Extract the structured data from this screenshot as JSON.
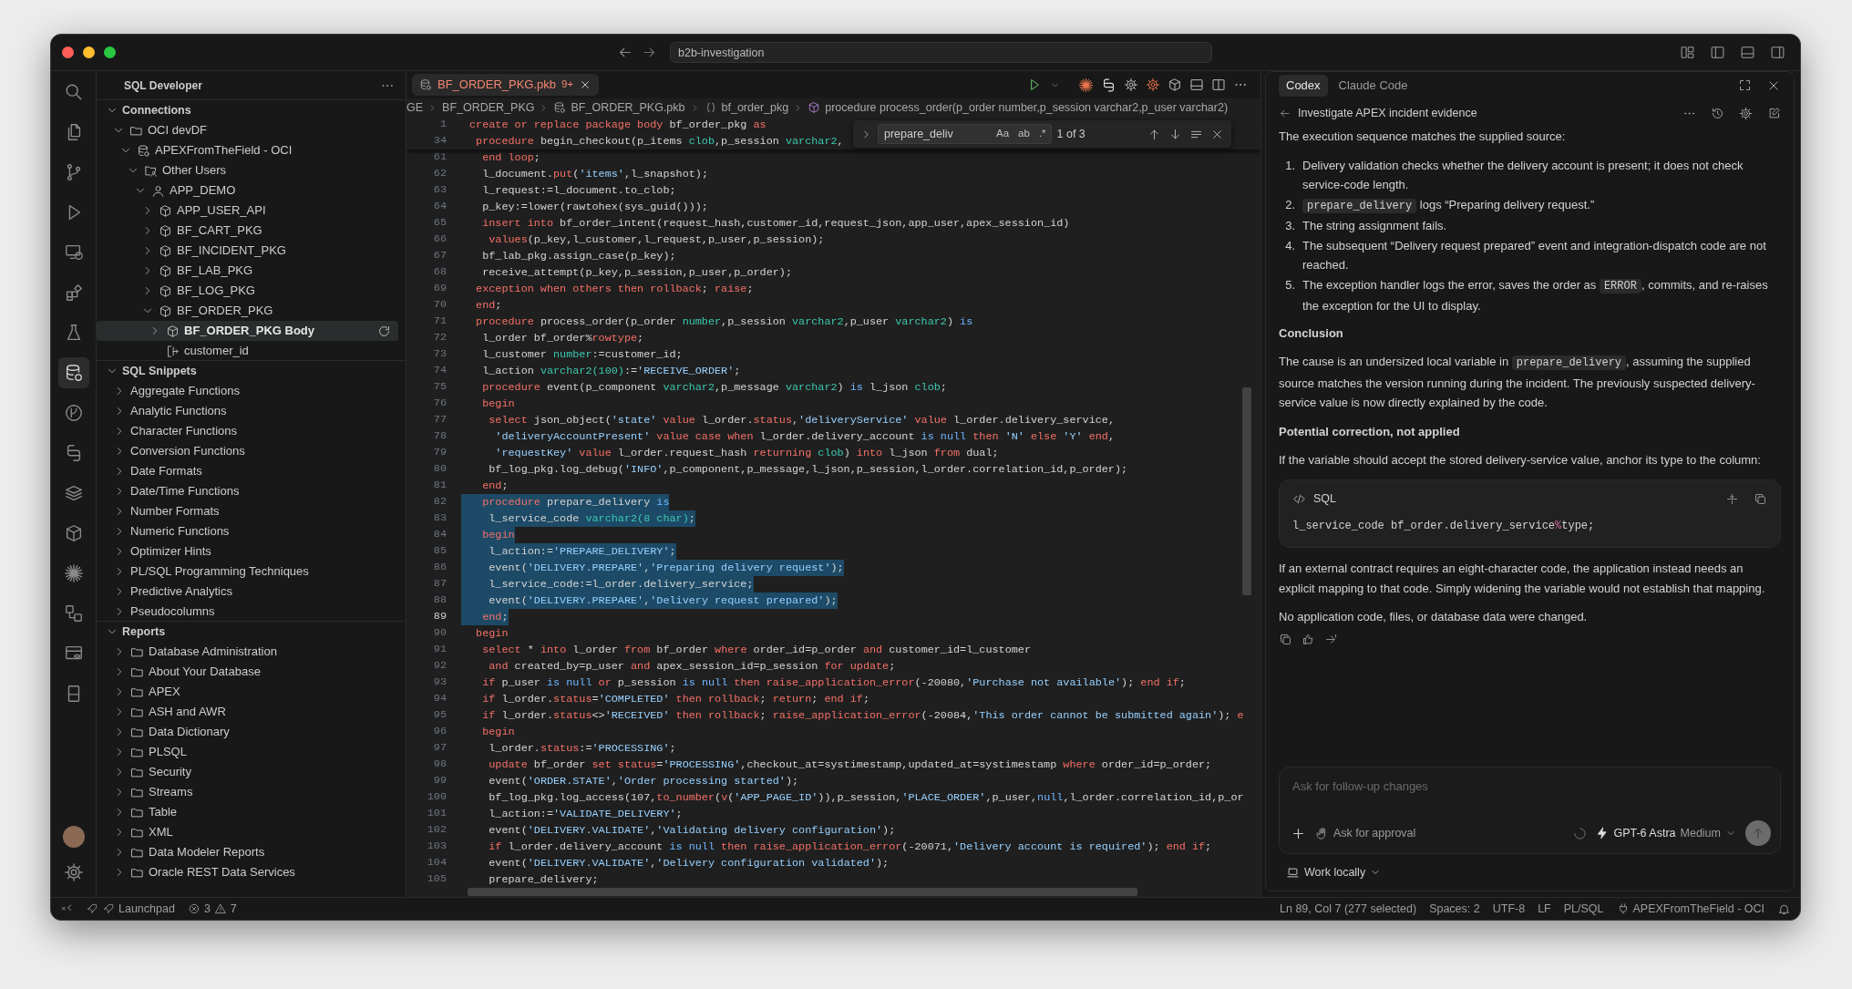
{
  "window": {
    "title": "b2b-investigation"
  },
  "sidebar": {
    "title": "SQL Developer",
    "sections": [
      {
        "title": "Connections",
        "expanded": true,
        "items": [
          {
            "label": "OCI devDF",
            "kind": "folder",
            "expanded": true,
            "selected": false,
            "children": [
              {
                "label": "APEXFromTheField - OCI",
                "kind": "connection",
                "expanded": true,
                "selected": false,
                "children": [
                  {
                    "label": "Other Users",
                    "kind": "users-folder",
                    "expanded": true,
                    "selected": false,
                    "children": [
                      {
                        "label": "APP_DEMO",
                        "kind": "user",
                        "expanded": true,
                        "selected": false,
                        "children": [
                          {
                            "label": "APP_USER_API",
                            "kind": "package",
                            "expanded": false,
                            "selected": false
                          },
                          {
                            "label": "BF_CART_PKG",
                            "kind": "package",
                            "expanded": false,
                            "selected": false
                          },
                          {
                            "label": "BF_INCIDENT_PKG",
                            "kind": "package",
                            "expanded": false,
                            "selected": false
                          },
                          {
                            "label": "BF_LAB_PKG",
                            "kind": "package",
                            "expanded": false,
                            "selected": false
                          },
                          {
                            "label": "BF_LOG_PKG",
                            "kind": "package",
                            "expanded": false,
                            "selected": false
                          },
                          {
                            "label": "BF_ORDER_PKG",
                            "kind": "package",
                            "expanded": true,
                            "selected": false,
                            "children": [
                              {
                                "label": "BF_ORDER_PKG Body",
                                "kind": "package",
                                "expanded": false,
                                "selected": true
                              },
                              {
                                "label": "customer_id",
                                "kind": "column",
                                "selected": false
                              }
                            ]
                          }
                        ]
                      }
                    ]
                  }
                ]
              }
            ]
          }
        ]
      },
      {
        "title": "SQL Snippets",
        "expanded": true,
        "items": [
          {
            "label": "Aggregate Functions",
            "expanded": false,
            "selected": false
          },
          {
            "label": "Analytic Functions",
            "expanded": false,
            "selected": false
          },
          {
            "label": "Character Functions",
            "expanded": false,
            "selected": false
          },
          {
            "label": "Conversion Functions",
            "expanded": false,
            "selected": false
          },
          {
            "label": "Date Formats",
            "expanded": false,
            "selected": false
          },
          {
            "label": "Date/Time Functions",
            "expanded": false,
            "selected": false
          },
          {
            "label": "Number Formats",
            "expanded": false,
            "selected": false
          },
          {
            "label": "Numeric Functions",
            "expanded": false,
            "selected": false
          },
          {
            "label": "Optimizer Hints",
            "expanded": false,
            "selected": false
          },
          {
            "label": "PL/SQL Programming Techniques",
            "expanded": false,
            "selected": false
          },
          {
            "label": "Predictive Analytics",
            "expanded": false,
            "selected": false
          },
          {
            "label": "Pseudocolumns",
            "expanded": false,
            "selected": false
          }
        ]
      },
      {
        "title": "Reports",
        "expanded": true,
        "items": [
          {
            "label": "Database Administration",
            "kind": "folder",
            "expanded": false,
            "selected": false
          },
          {
            "label": "About Your Database",
            "kind": "folder",
            "expanded": false,
            "selected": false
          },
          {
            "label": "APEX",
            "kind": "folder",
            "expanded": false,
            "selected": false
          },
          {
            "label": "ASH and AWR",
            "kind": "folder",
            "expanded": false,
            "selected": false
          },
          {
            "label": "Data Dictionary",
            "kind": "folder",
            "expanded": false,
            "selected": false
          },
          {
            "label": "PLSQL",
            "kind": "folder",
            "expanded": false,
            "selected": false
          },
          {
            "label": "Security",
            "kind": "folder",
            "expanded": false,
            "selected": false
          },
          {
            "label": "Streams",
            "kind": "folder",
            "expanded": false,
            "selected": false
          },
          {
            "label": "Table",
            "kind": "folder",
            "expanded": false,
            "selected": false
          },
          {
            "label": "XML",
            "kind": "folder",
            "expanded": false,
            "selected": false
          },
          {
            "label": "Data Modeler Reports",
            "kind": "folder",
            "expanded": false,
            "selected": false
          },
          {
            "label": "Oracle REST Data Services",
            "kind": "folder",
            "expanded": false,
            "selected": false
          }
        ]
      }
    ]
  },
  "editor": {
    "tabs": [
      {
        "label": "BF_ORDER_PKG.pkb",
        "badge": "9+",
        "selected": true
      }
    ],
    "breadcrumb": [
      {
        "label": "GE",
        "kind": "folder"
      },
      {
        "label": "BF_ORDER_PKG",
        "kind": "folder"
      },
      {
        "label": "BF_ORDER_PKG.pkb",
        "kind": "file"
      },
      {
        "label": "bf_order_pkg",
        "kind": "namespace"
      },
      {
        "label": "procedure process_order(p_order number,p_session varchar2,p_user varchar2)",
        "kind": "method"
      }
    ],
    "find": {
      "value": "prepare_deliv",
      "options": [
        "Aa",
        "ab",
        ".*"
      ],
      "count": "1 of 3"
    },
    "lines": [
      {
        "number": "1",
        "sticky": true,
        "selected": false,
        "spans": [
          {
            "text": "create or replace package body",
            "kind": "keyword"
          },
          " bf_order_pkg ",
          {
            "text": "as",
            "kind": "keyword"
          }
        ]
      },
      {
        "number": "34",
        "sticky": true,
        "selected": false,
        "spans": [
          {
            "text": " procedure",
            "kind": "keyword"
          },
          " begin_checkout(p_items ",
          {
            "text": "clob",
            "kind": "type"
          },
          ",p_session ",
          {
            "text": "varchar2",
            "kind": "type"
          },
          ","
        ]
      },
      {
        "number": "61",
        "selected": false,
        "spans": [
          {
            "text": "  end loop",
            "kind": "keyword"
          },
          ";"
        ]
      },
      {
        "number": "62",
        "selected": false,
        "spans": [
          "  l_document.",
          {
            "text": "put",
            "kind": "keyword"
          },
          "(",
          {
            "text": "'items'",
            "kind": "string"
          },
          ",l_snapshot);"
        ]
      },
      {
        "number": "63",
        "selected": false,
        "spans": [
          "  l_request:=l_document.to_clob;"
        ]
      },
      {
        "number": "64",
        "selected": false,
        "spans": [
          "  p_key:=lower(rawtohex(sys_guid()));"
        ]
      },
      {
        "number": "65",
        "selected": false,
        "spans": [
          {
            "text": "  insert into",
            "kind": "keyword"
          },
          " bf_order_intent(request_hash,customer_id,request_json,app_user,apex_session_id)"
        ]
      },
      {
        "number": "66",
        "selected": false,
        "spans": [
          {
            "text": "   values",
            "kind": "keyword"
          },
          "(p_key,l_customer,l_request,p_user,p_session);"
        ]
      },
      {
        "number": "67",
        "selected": false,
        "spans": [
          "  bf_lab_pkg.assign_case(p_key);"
        ]
      },
      {
        "number": "68",
        "selected": false,
        "spans": [
          "  receive_attempt(p_key,p_session,p_user,p_order);"
        ]
      },
      {
        "number": "69",
        "selected": false,
        "spans": [
          {
            "text": " exception when others then rollback",
            "kind": "keyword"
          },
          "; ",
          {
            "text": "raise",
            "kind": "keyword"
          },
          ";"
        ]
      },
      {
        "number": "70",
        "selected": false,
        "spans": [
          {
            "text": " end",
            "kind": "keyword"
          },
          ";"
        ]
      },
      {
        "number": "71",
        "selected": false,
        "spans": [
          {
            "text": " procedure",
            "kind": "keyword"
          },
          " process_order(p_order ",
          {
            "text": "number",
            "kind": "type"
          },
          ",p_session ",
          {
            "text": "varchar2",
            "kind": "type"
          },
          ",p_user ",
          {
            "text": "varchar2",
            "kind": "type"
          },
          ") ",
          {
            "text": "is",
            "kind": "literal"
          }
        ]
      },
      {
        "number": "72",
        "selected": false,
        "spans": [
          "  l_order bf_order%",
          {
            "text": "rowtype",
            "kind": "keyword"
          },
          ";"
        ]
      },
      {
        "number": "73",
        "selected": false,
        "spans": [
          "  l_customer ",
          {
            "text": "number",
            "kind": "type"
          },
          ":=customer_id;"
        ]
      },
      {
        "number": "74",
        "selected": false,
        "spans": [
          "  l_action ",
          {
            "text": "varchar2(100)",
            "kind": "type"
          },
          ":=",
          {
            "text": "'RECEIVE_ORDER'",
            "kind": "string"
          },
          ";"
        ]
      },
      {
        "number": "75",
        "selected": false,
        "spans": [
          {
            "text": "  procedure",
            "kind": "keyword"
          },
          " event(p_component ",
          {
            "text": "varchar2",
            "kind": "type"
          },
          ",p_message ",
          {
            "text": "varchar2",
            "kind": "type"
          },
          ") ",
          {
            "text": "is",
            "kind": "literal"
          },
          " l_json ",
          {
            "text": "clob",
            "kind": "type"
          },
          ";"
        ]
      },
      {
        "number": "76",
        "selected": false,
        "spans": [
          {
            "text": "  begin",
            "kind": "keyword"
          }
        ]
      },
      {
        "number": "77",
        "selected": false,
        "spans": [
          {
            "text": "   select",
            "kind": "keyword"
          },
          " json_object(",
          {
            "text": "'state' ",
            "kind": "string"
          },
          {
            "text": "value",
            "kind": "keyword"
          },
          " l_order.",
          {
            "text": "status",
            "kind": "keyword"
          },
          ",",
          {
            "text": "'deliveryService' ",
            "kind": "string"
          },
          {
            "text": "value",
            "kind": "keyword"
          },
          " l_order.delivery_service,"
        ]
      },
      {
        "number": "78",
        "selected": false,
        "spans": [
          {
            "text": "    'deliveryAccountPresent' ",
            "kind": "string"
          },
          {
            "text": "value case when",
            "kind": "keyword"
          },
          " l_order.delivery_account ",
          {
            "text": "is null ",
            "kind": "literal"
          },
          {
            "text": "then ",
            "kind": "keyword"
          },
          {
            "text": "'N' ",
            "kind": "string"
          },
          {
            "text": "else ",
            "kind": "keyword"
          },
          {
            "text": "'Y' ",
            "kind": "string"
          },
          {
            "text": "end",
            "kind": "keyword"
          },
          ","
        ]
      },
      {
        "number": "79",
        "selected": false,
        "spans": [
          {
            "text": "    'requestKey' ",
            "kind": "string"
          },
          {
            "text": "value",
            "kind": "keyword"
          },
          " l_order.request_hash ",
          {
            "text": "returning ",
            "kind": "keyword"
          },
          {
            "text": "clob",
            "kind": "type"
          },
          ") ",
          {
            "text": "into",
            "kind": "keyword"
          },
          " l_json ",
          {
            "text": "from",
            "kind": "keyword"
          },
          " dual;"
        ]
      },
      {
        "number": "80",
        "selected": false,
        "spans": [
          "   bf_log_pkg.log_debug(",
          {
            "text": "'INFO'",
            "kind": "string"
          },
          ",p_component,p_message,l_json,p_session,l_order.correlation_id,p_order);"
        ]
      },
      {
        "number": "81",
        "selected": false,
        "spans": [
          {
            "text": "  end",
            "kind": "keyword"
          },
          ";"
        ]
      },
      {
        "number": "82",
        "selected": true,
        "spans": [
          {
            "text": "  procedure",
            "kind": "keyword"
          },
          " prepare_delivery ",
          {
            "text": "is",
            "kind": "literal"
          }
        ]
      },
      {
        "number": "83",
        "selected": true,
        "spans": [
          "   l_service_code ",
          {
            "text": "varchar2(8 char)",
            "kind": "type"
          },
          ";"
        ]
      },
      {
        "number": "84",
        "selected": true,
        "spans": [
          {
            "text": "  begin",
            "kind": "keyword"
          }
        ]
      },
      {
        "number": "85",
        "selected": true,
        "spans": [
          "   l_action:=",
          {
            "text": "'PREPARE_DELIVERY'",
            "kind": "string"
          },
          ";"
        ]
      },
      {
        "number": "86",
        "selected": true,
        "spans": [
          "   event(",
          {
            "text": "'DELIVERY.PREPARE'",
            "kind": "string"
          },
          ",",
          {
            "text": "'Preparing delivery request'",
            "kind": "string"
          },
          ");"
        ]
      },
      {
        "number": "87",
        "selected": true,
        "spans": [
          "   l_service_code:=l_order.delivery_service;"
        ]
      },
      {
        "number": "88",
        "selected": true,
        "spans": [
          "   event(",
          {
            "text": "'DELIVERY.PREPARE'",
            "kind": "string"
          },
          ",",
          {
            "text": "'Delivery request prepared'",
            "kind": "string"
          },
          ");"
        ]
      },
      {
        "number": "89",
        "current": true,
        "selected": true,
        "spans": [
          {
            "text": "  end",
            "kind": "keyword"
          },
          ";"
        ]
      },
      {
        "number": "90",
        "selected": false,
        "spans": [
          {
            "text": " begin",
            "kind": "keyword"
          }
        ]
      },
      {
        "number": "91",
        "selected": false,
        "spans": [
          {
            "text": "  select",
            "kind": "keyword"
          },
          " * ",
          {
            "text": "into",
            "kind": "keyword"
          },
          " l_order ",
          {
            "text": "from",
            "kind": "keyword"
          },
          " bf_order ",
          {
            "text": "where",
            "kind": "keyword"
          },
          " order_id=p_order ",
          {
            "text": "and",
            "kind": "keyword"
          },
          " customer_id=l_customer"
        ]
      },
      {
        "number": "92",
        "selected": false,
        "spans": [
          {
            "text": "   and",
            "kind": "keyword"
          },
          " created_by=p_user ",
          {
            "text": "and",
            "kind": "keyword"
          },
          " apex_session_id=p_session ",
          {
            "text": "for update",
            "kind": "keyword"
          },
          ";"
        ]
      },
      {
        "number": "93",
        "selected": false,
        "spans": [
          {
            "text": "  if",
            "kind": "keyword"
          },
          " p_user ",
          {
            "text": "is null ",
            "kind": "literal"
          },
          {
            "text": "or",
            "kind": "keyword"
          },
          " p_session ",
          {
            "text": "is null ",
            "kind": "literal"
          },
          {
            "text": "then raise_application_error",
            "kind": "keyword"
          },
          "(-20080,",
          {
            "text": "'Purchase not available'",
            "kind": "string"
          },
          "); ",
          {
            "text": "end if",
            "kind": "keyword"
          },
          ";"
        ]
      },
      {
        "number": "94",
        "selected": false,
        "spans": [
          {
            "text": "  if",
            "kind": "keyword"
          },
          " l_order.",
          {
            "text": "status",
            "kind": "keyword"
          },
          "=",
          {
            "text": "'COMPLETED' ",
            "kind": "string"
          },
          {
            "text": "then rollback",
            "kind": "keyword"
          },
          "; ",
          {
            "text": "return",
            "kind": "keyword"
          },
          "; ",
          {
            "text": "end if",
            "kind": "keyword"
          },
          ";"
        ]
      },
      {
        "number": "95",
        "selected": false,
        "spans": [
          {
            "text": "  if",
            "kind": "keyword"
          },
          " l_order.",
          {
            "text": "status",
            "kind": "keyword"
          },
          "<>",
          {
            "text": "'RECEIVED' ",
            "kind": "string"
          },
          {
            "text": "then rollback",
            "kind": "keyword"
          },
          "; ",
          {
            "text": "raise_application_error",
            "kind": "keyword"
          },
          "(-20084,",
          {
            "text": "'This order cannot be submitted again'",
            "kind": "string"
          },
          "); ",
          {
            "text": "e",
            "kind": "keyword"
          }
        ]
      },
      {
        "number": "96",
        "selected": false,
        "spans": [
          {
            "text": "  begin",
            "kind": "keyword"
          }
        ]
      },
      {
        "number": "97",
        "selected": false,
        "spans": [
          "   l_order.",
          {
            "text": "status",
            "kind": "keyword"
          },
          ":=",
          {
            "text": "'PROCESSING'",
            "kind": "string"
          },
          ";"
        ]
      },
      {
        "number": "98",
        "selected": false,
        "spans": [
          {
            "text": "   update",
            "kind": "keyword"
          },
          " bf_order ",
          {
            "text": "set status",
            "kind": "keyword"
          },
          "=",
          {
            "text": "'PROCESSING'",
            "kind": "string"
          },
          ",checkout_at=systimestamp,updated_at=systimestamp ",
          {
            "text": "where",
            "kind": "keyword"
          },
          " order_id=p_order;"
        ]
      },
      {
        "number": "99",
        "selected": false,
        "spans": [
          "   event(",
          {
            "text": "'ORDER.STATE'",
            "kind": "string"
          },
          ",",
          {
            "text": "'Order processing started'",
            "kind": "string"
          },
          ");"
        ]
      },
      {
        "number": "100",
        "selected": false,
        "spans": [
          "   bf_log_pkg.log_access(107,",
          {
            "text": "to_number",
            "kind": "keyword"
          },
          "(",
          {
            "text": "v",
            "kind": "keyword"
          },
          "(",
          {
            "text": "'APP_PAGE_ID'",
            "kind": "string"
          },
          ")),p_session,",
          {
            "text": "'PLACE_ORDER'",
            "kind": "string"
          },
          ",p_user,",
          {
            "text": "null",
            "kind": "literal"
          },
          ",l_order.correlation_id,p_or"
        ]
      },
      {
        "number": "101",
        "selected": false,
        "spans": [
          "   l_action:=",
          {
            "text": "'VALIDATE_DELIVERY'",
            "kind": "string"
          },
          ";"
        ]
      },
      {
        "number": "102",
        "selected": false,
        "spans": [
          "   event(",
          {
            "text": "'DELIVERY.VALIDATE'",
            "kind": "string"
          },
          ",",
          {
            "text": "'Validating delivery configuration'",
            "kind": "string"
          },
          ");"
        ]
      },
      {
        "number": "103",
        "selected": false,
        "spans": [
          {
            "text": "   if",
            "kind": "keyword"
          },
          " l_order.delivery_account ",
          {
            "text": "is null ",
            "kind": "literal"
          },
          {
            "text": "then raise_application_error",
            "kind": "keyword"
          },
          "(-20071,",
          {
            "text": "'Delivery account is required'",
            "kind": "string"
          },
          "); ",
          {
            "text": "end if",
            "kind": "keyword"
          },
          ";"
        ]
      },
      {
        "number": "104",
        "selected": false,
        "spans": [
          "   event(",
          {
            "text": "'DELIVERY.VALIDATE'",
            "kind": "string"
          },
          ",",
          {
            "text": "'Delivery configuration validated'",
            "kind": "string"
          },
          ");"
        ]
      },
      {
        "number": "105",
        "selected": false,
        "spans": [
          "   prepare_delivery;"
        ]
      }
    ]
  },
  "chat": {
    "tabs": [
      {
        "label": "Codex",
        "selected": true
      },
      {
        "label": "Claude Code",
        "selected": false
      }
    ],
    "thread_title": "Investigate APEX incident evidence",
    "blocks": [
      {
        "kind": "paragraph",
        "segments": [
          "The execution sequence matches the supplied source:"
        ]
      },
      {
        "kind": "list",
        "items": [
          {
            "number": "1.",
            "segments": [
              "Delivery validation checks whether the delivery account is present; it does not check service-code length."
            ]
          },
          {
            "number": "2.",
            "segments": [
              {
                "text": "prepare_delivery",
                "kind": "code"
              },
              " logs “Preparing delivery request.”"
            ]
          },
          {
            "number": "3.",
            "segments": [
              "The string assignment fails."
            ]
          },
          {
            "number": "4.",
            "segments": [
              "The subsequent “Delivery request prepared” event and integration-dispatch code are not reached."
            ]
          },
          {
            "number": "5.",
            "segments": [
              "The exception handler logs the error, saves the order as ",
              {
                "text": "ERROR",
                "kind": "code"
              },
              ", commits, and re-raises the exception for the UI to display."
            ]
          }
        ]
      },
      {
        "kind": "heading",
        "segments": [
          "Conclusion"
        ]
      },
      {
        "kind": "paragraph",
        "segments": [
          "The cause is an undersized local variable in ",
          {
            "text": "prepare_delivery",
            "kind": "code"
          },
          ", assuming the supplied source matches the version running during the incident. The previously suspected delivery-service value is now directly explained by the code."
        ]
      },
      {
        "kind": "heading",
        "segments": [
          "Potential correction, not applied"
        ]
      },
      {
        "kind": "paragraph",
        "segments": [
          "If the variable should accept the stored delivery-service value, anchor its type to the column:"
        ]
      },
      {
        "kind": "code",
        "language": "SQL",
        "segments": [
          "l_service_code bf_order.delivery_service",
          {
            "text": "%",
            "kind": "operator"
          },
          "type;"
        ]
      },
      {
        "kind": "paragraph",
        "segments": [
          "If an external contract requires an eight-character code, the application instead needs an explicit mapping to that code. Simply widening the variable would not establish that mapping."
        ]
      },
      {
        "kind": "paragraph",
        "segments": [
          "No application code, files, or database data were changed."
        ]
      }
    ],
    "composer": {
      "placeholder": "Ask for follow-up changes",
      "approval": "Ask for approval",
      "model": "GPT-6 Astra",
      "effort": "Medium",
      "location": "Work locally"
    }
  },
  "status_bar": {
    "launchpad": "Launchpad",
    "errors": "3",
    "warnings": "7",
    "position": "Ln 89, Col 7 (277 selected)",
    "indent": "Spaces: 2",
    "encoding": "UTF-8",
    "eol": "LF",
    "language": "PL/SQL",
    "connection": "APEXFromTheField - OCI"
  }
}
